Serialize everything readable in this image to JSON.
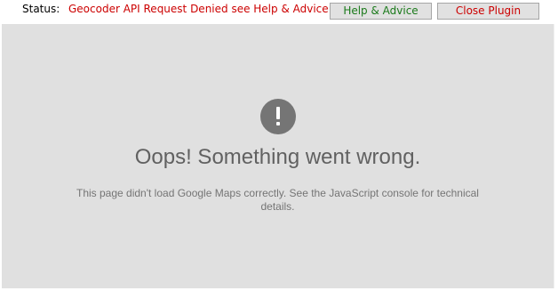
{
  "status": {
    "label": "Status:",
    "message": "Geocoder API Request Denied see Help & Advice F.A.Q."
  },
  "buttons": {
    "help_label": "Help & Advice",
    "close_label": "Close Plugin"
  },
  "map_error": {
    "icon": "exclamation-icon",
    "title": "Oops! Something went wrong.",
    "detail": "This page didn't load Google Maps correctly. See the JavaScript console for technical details."
  },
  "colors": {
    "status_message": "#cc0000",
    "help_button_text": "#1a7a1a",
    "close_button_text": "#cc0000",
    "map_background": "#e0e0e0",
    "icon_background": "#757575"
  }
}
